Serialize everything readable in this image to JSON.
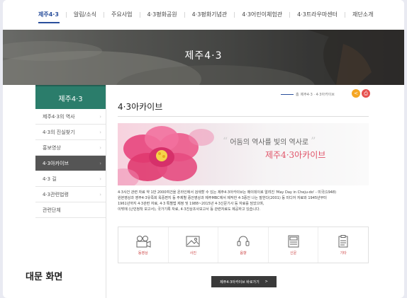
{
  "topnav": {
    "items": [
      "제주4·3",
      "알림/소식",
      "주요사업",
      "4·3평화공원",
      "4·3평화기념관",
      "4·3어린이체험관",
      "4·3트라우마센터",
      "재단소개"
    ],
    "active_index": 0
  },
  "banner": {
    "title": "제주4·3"
  },
  "sidebar": {
    "heading": "제주4·3",
    "items": [
      {
        "label": "제주4·3의 역사"
      },
      {
        "label": "4·3의 진실찾기"
      },
      {
        "label": "홍보영상"
      },
      {
        "label": "4·3아카이브"
      },
      {
        "label": "4·3 길"
      },
      {
        "label": "4·3관련법령"
      },
      {
        "label": "관련단체"
      }
    ],
    "active_index": 3
  },
  "breadcrumb": {
    "home": "홈",
    "path": "제주4·3 · 4·3아카이브"
  },
  "share_icon": "share-icon",
  "print_icon": "print-icon",
  "page_title": "4·3아카이브",
  "hero": {
    "quote": "어둠의 역사를 빛의 역사로",
    "subtitle": "제주4·3아카이브"
  },
  "description": {
    "lines": [
      "4·3사건 관련 자료 약 1만 2000여건을 온라인에서 검색할 수 있는 제주4·3아카이브는 메이데이로 알려진 'May Day in Cheju-do' - 미국(1948)",
      "원본영상과 영주4·3유족회 옥중편지 등 주제별 증언영상과 제주MBC에서 제작한 4·3증언 나는 말한다(2001) 등 미디어 자료와 1945년부터",
      "1961년까지 4·3관련 자료, 4·3 특별법 제정 및 1988~2015년 4·3신문기사 등 자료를 담았으며,",
      "이밖에 (난민정착 보고서), 국가기록 자료, 4·3진상조사보고서 등 관련자료도 제공하고 있습니다."
    ]
  },
  "categories": [
    {
      "label": "동영상",
      "icon": "video-camera-icon"
    },
    {
      "label": "사진",
      "icon": "photo-icon"
    },
    {
      "label": "음향",
      "icon": "audio-icon"
    },
    {
      "label": "신문",
      "icon": "newspaper-icon"
    },
    {
      "label": "기타",
      "icon": "document-icon"
    }
  ],
  "go_button": {
    "label": "제주4·3아카이브 바로가기",
    "arrow": ">"
  },
  "caption": "대문 화면",
  "colors": {
    "nav_active": "#2a4f9c",
    "sidebar_head": "#2b7d6b",
    "sidebar_active": "#555555",
    "accent_red": "#e05267",
    "share": "#f5a623",
    "print": "#e6504d"
  }
}
